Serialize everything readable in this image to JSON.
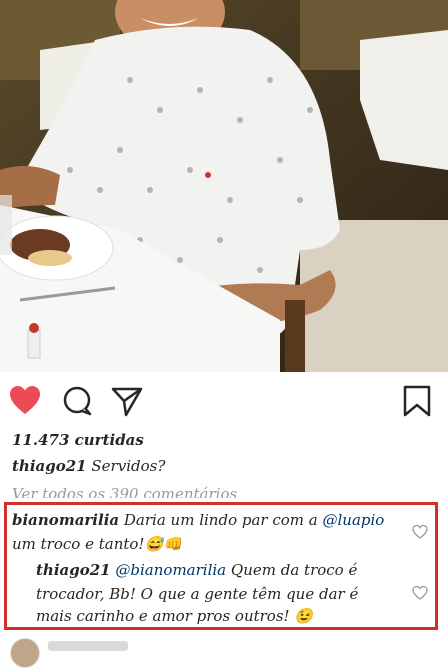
{
  "post": {
    "likes": "11.473 curtidas",
    "caption_user": "thiago21",
    "caption_text": "Servidos?",
    "view_all": "Ver todos os 390 comentários"
  },
  "comments": [
    {
      "user": "bianomarilia",
      "text_before": "Daria um lindo par com a",
      "mention": "@luapio",
      "line2": "um troco e tanto!😅👊"
    },
    {
      "user": "thiago21",
      "mention": "@bianomarilia",
      "text_after": "Quem da troco é",
      "line2": "trocador, Bb! O que a gente têm que dar é",
      "line3": "mais carinho e amor pros outros! 😉"
    }
  ],
  "icons": [
    "heart-icon",
    "comment-icon",
    "share-icon",
    "bookmark-icon"
  ],
  "colors": {
    "like_red": "#ed4956",
    "highlight_border": "#d32f2f",
    "mention_blue": "#003569"
  }
}
